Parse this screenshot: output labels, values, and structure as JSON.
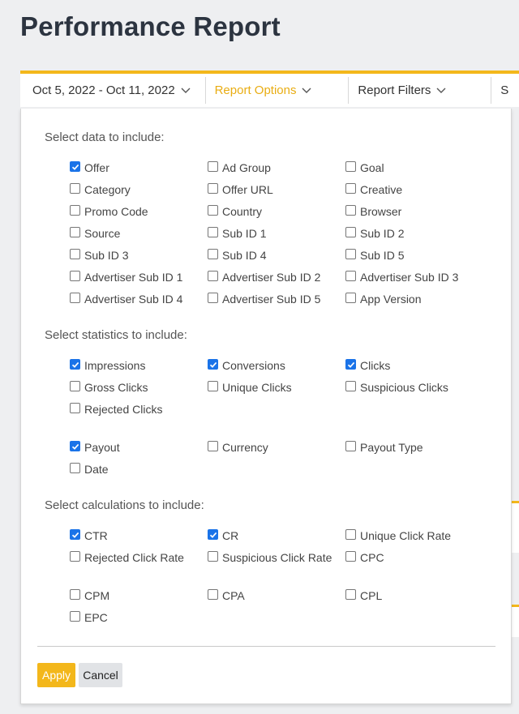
{
  "page": {
    "title": "Performance Report"
  },
  "toolbar": {
    "date_range": "Oct 5, 2022 - Oct 11, 2022",
    "report_options": "Report Options",
    "report_filters": "Report Filters",
    "extra": "S"
  },
  "colors": {
    "accent": "#f3b71b",
    "checkbox": "#1a73e8"
  },
  "sections": {
    "data": {
      "title": "Select data to include:",
      "options": [
        {
          "label": "Offer",
          "checked": true
        },
        {
          "label": "Ad Group",
          "checked": false
        },
        {
          "label": "Goal",
          "checked": false
        },
        {
          "label": "Category",
          "checked": false
        },
        {
          "label": "Offer URL",
          "checked": false
        },
        {
          "label": "Creative",
          "checked": false
        },
        {
          "label": "Promo Code",
          "checked": false
        },
        {
          "label": "Country",
          "checked": false
        },
        {
          "label": "Browser",
          "checked": false
        },
        {
          "label": "Source",
          "checked": false
        },
        {
          "label": "Sub ID 1",
          "checked": false
        },
        {
          "label": "Sub ID 2",
          "checked": false
        },
        {
          "label": "Sub ID 3",
          "checked": false
        },
        {
          "label": "Sub ID 4",
          "checked": false
        },
        {
          "label": "Sub ID 5",
          "checked": false
        },
        {
          "label": "Advertiser Sub ID 1",
          "checked": false
        },
        {
          "label": "Advertiser Sub ID 2",
          "checked": false
        },
        {
          "label": "Advertiser Sub ID 3",
          "checked": false
        },
        {
          "label": "Advertiser Sub ID 4",
          "checked": false
        },
        {
          "label": "Advertiser Sub ID 5",
          "checked": false
        },
        {
          "label": "App Version",
          "checked": false
        }
      ]
    },
    "statistics": {
      "title": "Select statistics to include:",
      "options": [
        {
          "label": "Impressions",
          "checked": true
        },
        {
          "label": "Conversions",
          "checked": true
        },
        {
          "label": "Clicks",
          "checked": true
        },
        {
          "label": "Gross Clicks",
          "checked": false
        },
        {
          "label": "Unique Clicks",
          "checked": false
        },
        {
          "label": "Suspicious Clicks",
          "checked": false
        },
        {
          "label": "Rejected Clicks",
          "checked": false
        },
        {
          "label": "Payout",
          "checked": true
        },
        {
          "label": "Currency",
          "checked": false
        },
        {
          "label": "Payout Type",
          "checked": false
        },
        {
          "label": "Date",
          "checked": false
        }
      ]
    },
    "calculations": {
      "title": "Select calculations to include:",
      "options": [
        {
          "label": "CTR",
          "checked": true
        },
        {
          "label": "CR",
          "checked": true
        },
        {
          "label": "Unique Click Rate",
          "checked": false
        },
        {
          "label": "Rejected Click Rate",
          "checked": false
        },
        {
          "label": "Suspicious Click Rate",
          "checked": false
        },
        {
          "label": "CPC",
          "checked": false
        },
        {
          "label": "CPM",
          "checked": false
        },
        {
          "label": "CPA",
          "checked": false
        },
        {
          "label": "CPL",
          "checked": false
        },
        {
          "label": "EPC",
          "checked": false
        }
      ]
    }
  },
  "actions": {
    "apply": "Apply",
    "cancel": "Cancel"
  }
}
